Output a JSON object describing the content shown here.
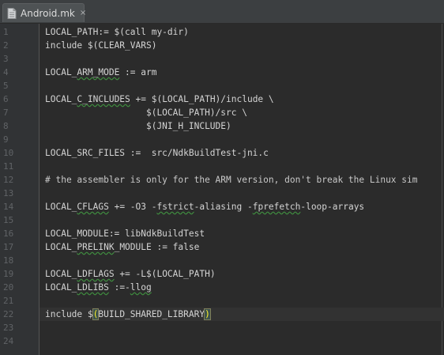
{
  "tab": {
    "filename": "Android.mk",
    "close_glyph": "×",
    "icon": "file-icon"
  },
  "colors": {
    "editor_bg": "#2b2b2b",
    "gutter_bg": "#313335",
    "text": "#d4d4d4",
    "line_number": "#606366",
    "typo_underline": "#3f8f3f",
    "paren_match_fg": "#ffef28",
    "paren_match_bg": "#3b514d"
  },
  "editor": {
    "current_line": 22,
    "lines": [
      {
        "n": "1",
        "text": "LOCAL_PATH:= $(call my-dir)"
      },
      {
        "n": "2",
        "text": "include $(CLEAR_VARS)"
      },
      {
        "n": "3",
        "text": ""
      },
      {
        "n": "4",
        "text": "LOCAL_ARM_MODE := arm"
      },
      {
        "n": "5",
        "text": ""
      },
      {
        "n": "6",
        "text": "LOCAL_C_INCLUDES += $(LOCAL_PATH)/include \\"
      },
      {
        "n": "7",
        "text": "                   $(LOCAL_PATH)/src \\"
      },
      {
        "n": "8",
        "text": "                   $(JNI_H_INCLUDE)"
      },
      {
        "n": "9",
        "text": ""
      },
      {
        "n": "10",
        "text": "LOCAL_SRC_FILES :=  src/NdkBuildTest-jni.c"
      },
      {
        "n": "11",
        "text": ""
      },
      {
        "n": "12",
        "text": "# the assembler is only for the ARM version, don't break the Linux sim"
      },
      {
        "n": "13",
        "text": ""
      },
      {
        "n": "14",
        "text": "LOCAL_CFLAGS += -O3 -fstrict-aliasing -fprefetch-loop-arrays"
      },
      {
        "n": "15",
        "text": ""
      },
      {
        "n": "16",
        "text": "LOCAL_MODULE:= libNdkBuildTest"
      },
      {
        "n": "17",
        "text": "LOCAL_PRELINK_MODULE := false"
      },
      {
        "n": "18",
        "text": ""
      },
      {
        "n": "19",
        "text": "LOCAL_LDFLAGS += -L$(LOCAL_PATH)"
      },
      {
        "n": "20",
        "text": "LOCAL_LDLIBS :=-llog"
      },
      {
        "n": "21",
        "text": ""
      },
      {
        "n": "22",
        "text": "include $(BUILD_SHARED_LIBRARY)"
      },
      {
        "n": "23",
        "text": ""
      },
      {
        "n": "24",
        "text": ""
      }
    ]
  }
}
